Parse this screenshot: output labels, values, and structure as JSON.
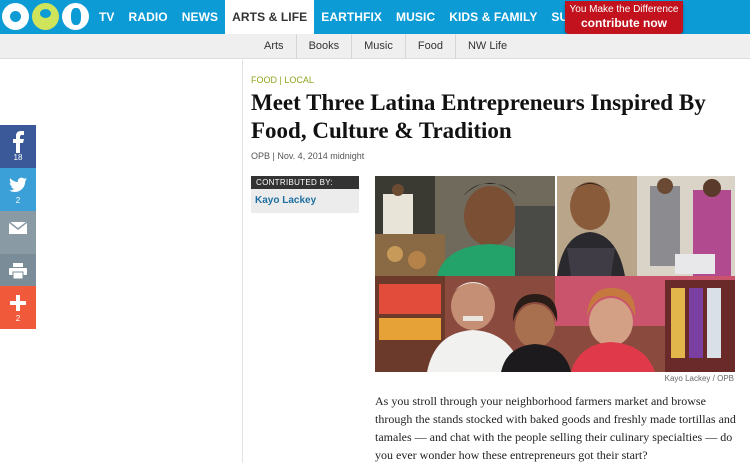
{
  "nav": {
    "items": [
      {
        "label": "TV"
      },
      {
        "label": "RADIO"
      },
      {
        "label": "NEWS"
      },
      {
        "label": "ARTS & LIFE"
      },
      {
        "label": "EARTHFIX"
      },
      {
        "label": "MUSIC"
      },
      {
        "label": "KIDS & FAMILY"
      },
      {
        "label": "SUPPORT"
      }
    ],
    "active": "ARTS & LIFE",
    "contribute": {
      "tagline": "You Make the Difference",
      "label": "contribute now"
    }
  },
  "subnav": {
    "items": [
      {
        "label": "Arts"
      },
      {
        "label": "Books"
      },
      {
        "label": "Music"
      },
      {
        "label": "Food"
      },
      {
        "label": "NW Life"
      }
    ]
  },
  "share": {
    "facebook": {
      "icon": "facebook-icon",
      "count": "18"
    },
    "twitter": {
      "icon": "twitter-icon",
      "count": "2"
    },
    "email": {
      "icon": "mail-icon"
    },
    "print": {
      "icon": "printer-icon"
    },
    "more": {
      "icon": "plus-icon",
      "count": "2"
    }
  },
  "article": {
    "kicker": "FOOD | LOCAL",
    "title": "Meet Three Latina Entrepreneurs Inspired By Food, Culture & Tradition",
    "byline": "OPB | Nov. 4, 2014 midnight",
    "contributed_label": "CONTRIBUTED BY:",
    "contributor": "Kayo Lackey",
    "photo_credit": "Kayo Lackey / OPB",
    "body": "As you stroll through your neighborhood farmers market and browse through the stands stocked with baked goods and freshly made tortillas and tamales — and chat with the people selling their culinary specialties — do you ever wonder how these entrepreneurs got their start?"
  },
  "colors": {
    "brand_blue": "#0d9bd6",
    "contribute_red": "#c1121d",
    "kicker_green": "#8fa51f",
    "facebook": "#3b5998",
    "twitter": "#3ba0d8",
    "more": "#f0593a"
  }
}
